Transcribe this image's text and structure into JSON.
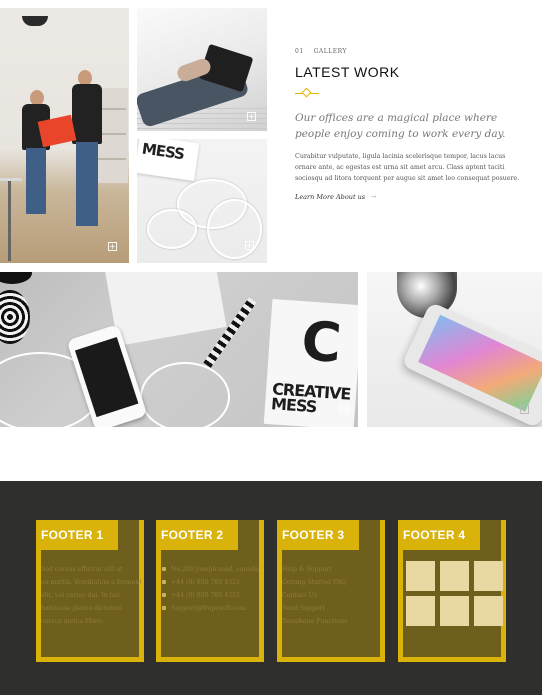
{
  "gallery": {
    "number": "01",
    "category": "GALLERY",
    "title": "LATEST WORK",
    "lead": "Our offices are a magical place where people enjoy coming to work every day.",
    "body": "Curabitur vulputate, ligula lacinia scelerisque tempor, lacus lacus ornare ante, ac egestas est urna sit amet arcu. Class aptent taciti sociosqu ad litora torquent per augue sit amet leo consequat posuere.",
    "link": "Learn More About us",
    "link_arrow": "→",
    "plus": "+"
  },
  "tiles": {
    "book_letter": "C",
    "book_text": "CREATIVE MESS",
    "mag_text": "MESS"
  },
  "footer": {
    "columns": [
      {
        "title": "FOOTER 1",
        "lines": [
          "Sed cursus efficitur elit at",
          "eu mattis. Vestibulum a fermentum",
          "elit, vel varius dui. In hac",
          "habitasse platea dictumst.",
          "cursus metus Moro."
        ]
      },
      {
        "title": "FOOTER 2",
        "lines": [
          "No.200 joseph road, canada",
          "+44 (0) 800 765 4321",
          "+44 (0) 800 765 4321",
          "Support@frapesoft.com"
        ]
      },
      {
        "title": "FOOTER 3",
        "lines": [
          "Help & Support",
          "Getting Started FAQ",
          "Contact Us",
          "Send Support",
          "Telephone Functions"
        ]
      },
      {
        "title": "FOOTER 4"
      }
    ]
  },
  "colors": {
    "accent": "#d9b20a",
    "footer_bg": "#2f2f2d",
    "footer_panel": "#6f5f1d"
  }
}
